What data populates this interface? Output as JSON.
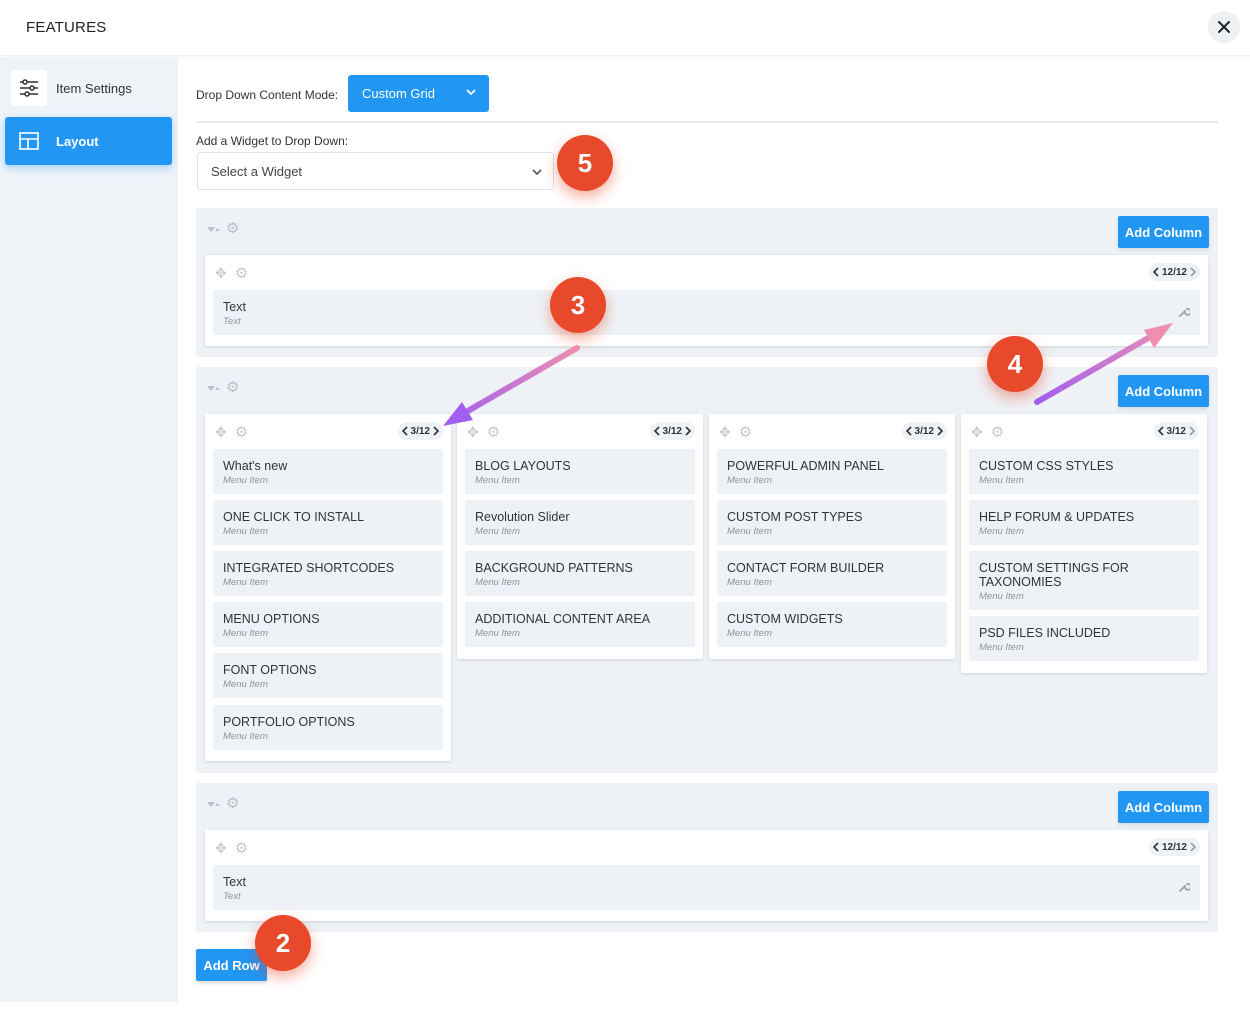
{
  "header": {
    "title": "FEATURES"
  },
  "sidebar": {
    "items": [
      {
        "label": "Item Settings",
        "icon": "sliders-icon"
      },
      {
        "label": "Layout",
        "icon": "layout-icon"
      }
    ]
  },
  "main": {
    "dropdown_mode_label": "Drop Down Content Mode:",
    "dropdown_mode_value": "Custom Grid",
    "add_widget_label": "Add a Widget to Drop Down:",
    "add_widget_placeholder": "Select a Widget",
    "add_column_label": "Add Column",
    "add_row_label": "Add Row",
    "rows": [
      {
        "columns": [
          {
            "span": "12/12",
            "items": [
              {
                "title": "Text",
                "subtitle": "Text"
              }
            ]
          }
        ]
      },
      {
        "columns": [
          {
            "span": "3/12",
            "items": [
              {
                "title": "What's new",
                "subtitle": "Menu Item"
              },
              {
                "title": "ONE CLICK TO INSTALL",
                "subtitle": "Menu Item"
              },
              {
                "title": "INTEGRATED SHORTCODES",
                "subtitle": "Menu Item"
              },
              {
                "title": "MENU OPTIONS",
                "subtitle": "Menu Item"
              },
              {
                "title": "FONT OPTIONS",
                "subtitle": "Menu Item"
              },
              {
                "title": "PORTFOLIO OPTIONS",
                "subtitle": "Menu Item"
              }
            ]
          },
          {
            "span": "3/12",
            "items": [
              {
                "title": "BLOG LAYOUTS",
                "subtitle": "Menu Item"
              },
              {
                "title": "Revolution Slider",
                "subtitle": "Menu Item"
              },
              {
                "title": "BACKGROUND PATTERNS",
                "subtitle": "Menu Item"
              },
              {
                "title": "ADDITIONAL CONTENT AREA",
                "subtitle": "Menu Item"
              }
            ]
          },
          {
            "span": "3/12",
            "items": [
              {
                "title": "POWERFUL ADMIN PANEL",
                "subtitle": "Menu Item"
              },
              {
                "title": "CUSTOM POST TYPES",
                "subtitle": "Menu Item"
              },
              {
                "title": "CONTACT FORM BUILDER",
                "subtitle": "Menu Item"
              },
              {
                "title": "CUSTOM WIDGETS",
                "subtitle": "Menu Item"
              }
            ]
          },
          {
            "span": "3/12",
            "items": [
              {
                "title": "CUSTOM CSS STYLES",
                "subtitle": "Menu Item"
              },
              {
                "title": "HELP FORUM & UPDATES",
                "subtitle": "Menu Item"
              },
              {
                "title": "CUSTOM SETTINGS FOR TAXONOMIES",
                "subtitle": "Menu Item"
              },
              {
                "title": "PSD FILES INCLUDED",
                "subtitle": "Menu Item"
              }
            ]
          }
        ]
      },
      {
        "columns": [
          {
            "span": "12/12",
            "items": [
              {
                "title": "Text",
                "subtitle": "Text"
              }
            ]
          }
        ]
      }
    ]
  },
  "annotations": [
    {
      "number": "2"
    },
    {
      "number": "3"
    },
    {
      "number": "4"
    },
    {
      "number": "5"
    }
  ],
  "colors": {
    "accent": "#2196f3",
    "badge": "#e8492b",
    "panel": "#eef2f6",
    "sidebar": "#eef3f8",
    "arrow_start": "#ee8fb0",
    "arrow_end": "#a05ff0"
  }
}
